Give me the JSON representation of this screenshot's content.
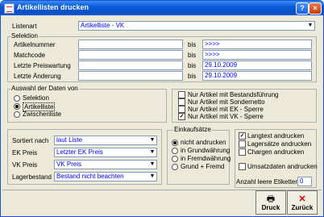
{
  "window": {
    "title": "Artikellisten drucken",
    "buttons": [
      "?",
      "×"
    ]
  },
  "listenart": {
    "label": "Listenart",
    "value": "Artikelliste - VK"
  },
  "selektion": {
    "title": "Selektion",
    "bis": "bis",
    "rows": [
      {
        "label": "Artikelnummer",
        "from": "",
        "to": ">>>>"
      },
      {
        "label": "Matchcode",
        "from": "",
        "to": ">>>>"
      },
      {
        "label": "Letzte Preiswartung",
        "from": "",
        "to": "29.10.2009"
      },
      {
        "label": "Letzte Änderung",
        "from": "",
        "to": "29.10.2009"
      }
    ]
  },
  "auswahl": {
    "title": "Auswahl der Daten von",
    "options": [
      {
        "label": "Selektion",
        "checked": false
      },
      {
        "label": "Artikelliste",
        "checked": true
      },
      {
        "label": "Zwischenliste",
        "checked": false
      }
    ]
  },
  "artikel_filter": [
    {
      "label": "Nur Artikel mit Bestandsführung",
      "checked": false
    },
    {
      "label": "Nur Artikel mit Sondernetto",
      "checked": false
    },
    {
      "label": "Nur Artikel mit EK - Sperre",
      "checked": false
    },
    {
      "label": "Nur Artikel mit VK - Sperre",
      "checked": true
    }
  ],
  "sortierung": {
    "rows": [
      {
        "label": "Sortiert nach",
        "value": "laut Liste"
      },
      {
        "label": "EK Preis",
        "value": "Letzter EK Preis"
      },
      {
        "label": "VK Preis",
        "value": "VK Preis"
      },
      {
        "label": "Lagerbestand",
        "value": "Bestand nicht beachten"
      }
    ]
  },
  "einkaufssaetze": {
    "title": "Einkaufsätze",
    "options": [
      {
        "label": "nicht andrucken",
        "checked": true
      },
      {
        "label": "in Grundwährung",
        "checked": false
      },
      {
        "label": "in Fremdwährung",
        "checked": false
      },
      {
        "label": "Grund + Fremd",
        "checked": false
      }
    ]
  },
  "druckoptionen": {
    "items": [
      {
        "label": "Langtext andrucken",
        "checked": true
      },
      {
        "label": "Lagersätze andrucken",
        "checked": false
      },
      {
        "label": "Chargen andrucken",
        "checked": false
      },
      {
        "label": "Umsatzdaten andrucken",
        "checked": false
      }
    ],
    "etiketten_label": "Anzahl leere Etiketten",
    "etiketten_value": "0"
  },
  "actions": {
    "print": "Druck",
    "back": "Zurück"
  }
}
